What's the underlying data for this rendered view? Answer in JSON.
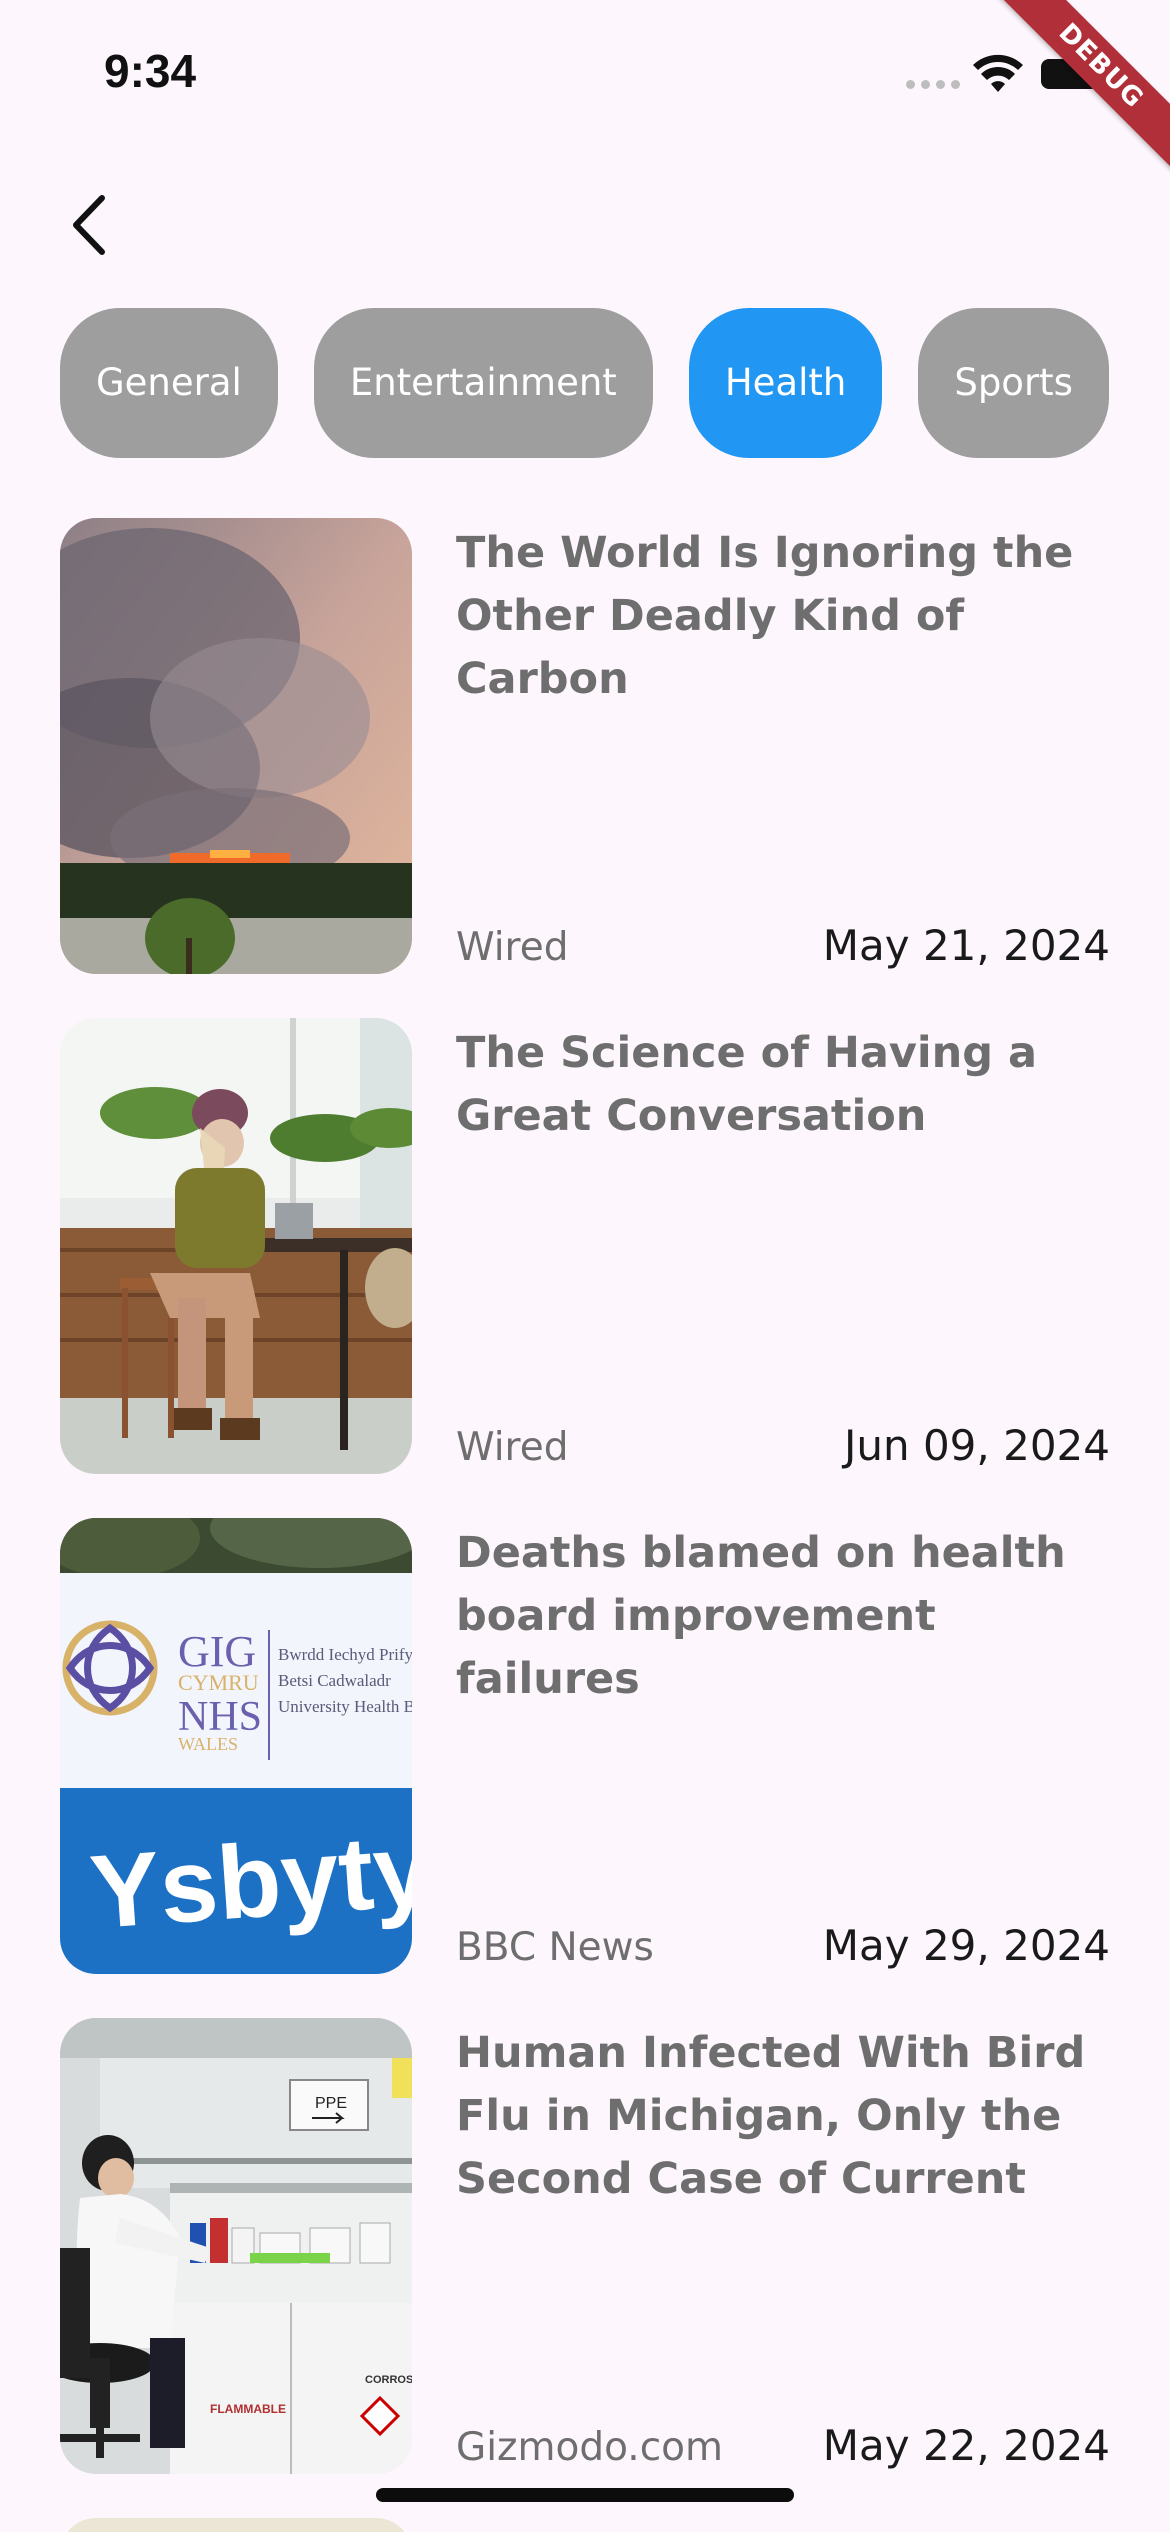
{
  "status_bar": {
    "time": "9:34",
    "debug_label": "DEBUG"
  },
  "nav": {
    "back_icon": "chevron-left-icon"
  },
  "categories": {
    "items": [
      "General",
      "Entertainment",
      "Health",
      "Sports"
    ],
    "selected": "Health",
    "active_color": "#2196f3",
    "inactive_color": "#9e9e9e"
  },
  "articles": [
    {
      "title": "The World Is Ignoring the Other Deadly Kind of Carbon",
      "source": "Wired",
      "date": "May 21, 2024",
      "thumbnail": "wildfire-smoke-image"
    },
    {
      "title": "The Science of Having a Great Conversation",
      "source": "Wired",
      "date": "Jun 09, 2024",
      "thumbnail": "cafe-conversation-image"
    },
    {
      "title": "Deaths blamed on health board improvement failures",
      "source": "BBC News",
      "date": "May 29, 2024",
      "thumbnail": "nhs-hospital-sign-image",
      "sign_text": {
        "gig": "GIG",
        "cymru": "CYMRU",
        "nhs": "NHS",
        "wales": "WALES",
        "line1": "Bwrdd Iechyd Prifysgol",
        "line2": "Betsi Cadwaladr",
        "line3": "University Health Board",
        "big": "Ysbyty"
      }
    },
    {
      "title": "Human Infected With Bird Flu in Michigan, Only the Second Case of Current",
      "source": "Gizmodo.com",
      "date": "May 22, 2024",
      "thumbnail": "lab-scientist-image",
      "lab_labels": {
        "ppe": "PPE",
        "flammable": "FLAMMABLE",
        "corrosives": "CORROSIVES"
      }
    }
  ]
}
